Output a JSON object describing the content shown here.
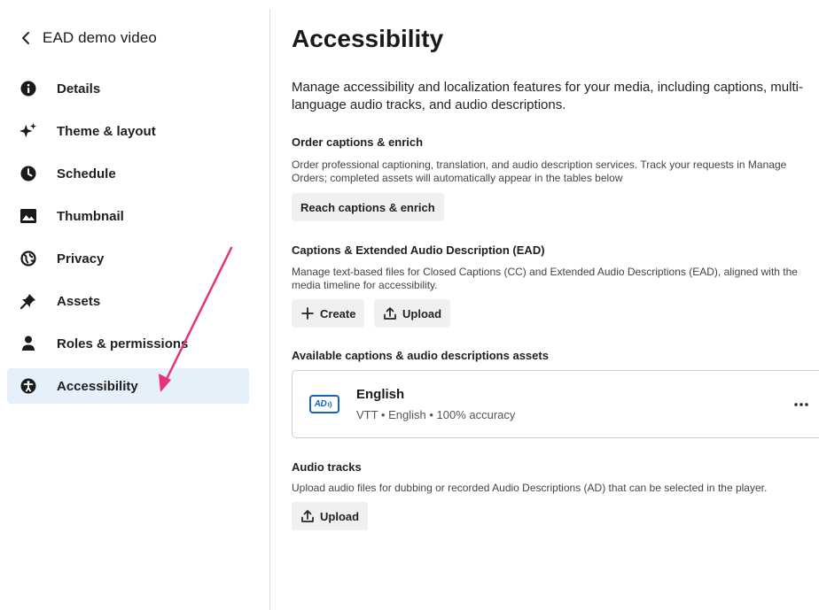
{
  "sidebar": {
    "back_title": "EAD demo video",
    "items": [
      {
        "label": "Details",
        "icon": "info-icon"
      },
      {
        "label": "Theme & layout",
        "icon": "sparkle-icon"
      },
      {
        "label": "Schedule",
        "icon": "clock-icon"
      },
      {
        "label": "Thumbnail",
        "icon": "image-icon"
      },
      {
        "label": "Privacy",
        "icon": "globe-icon"
      },
      {
        "label": "Assets",
        "icon": "pin-icon"
      },
      {
        "label": "Roles & permissions",
        "icon": "person-icon"
      },
      {
        "label": "Accessibility",
        "icon": "accessibility-icon",
        "active": true
      }
    ]
  },
  "main": {
    "title": "Accessibility",
    "intro": "Manage accessibility and localization features for your media, including captions, multi-language audio tracks, and audio descriptions.",
    "order": {
      "title": "Order captions & enrich",
      "desc": "Order professional captioning, translation, and audio description services. Track your requests in Manage Orders; completed assets will automatically appear in the tables below",
      "button": "Reach captions & enrich"
    },
    "captions": {
      "title": "Captions & Extended Audio Description (EAD)",
      "desc": "Manage text-based files for Closed Captions (CC) and Extended Audio Descriptions (EAD), aligned with the media timeline for accessibility.",
      "create_label": "Create",
      "upload_label": "Upload"
    },
    "available": {
      "title": "Available captions & audio descriptions assets",
      "asset": {
        "badge": "AD",
        "name": "English",
        "meta": "VTT • English • 100% accuracy"
      }
    },
    "audio": {
      "title": "Audio tracks",
      "desc": "Upload audio files for dubbing or recorded Audio Descriptions (AD) that can be selected in the player.",
      "upload_label": "Upload"
    }
  },
  "colors": {
    "active_bg": "#e6f0fb",
    "accent": "#1565c0",
    "annotation_arrow": "#e8317b"
  }
}
